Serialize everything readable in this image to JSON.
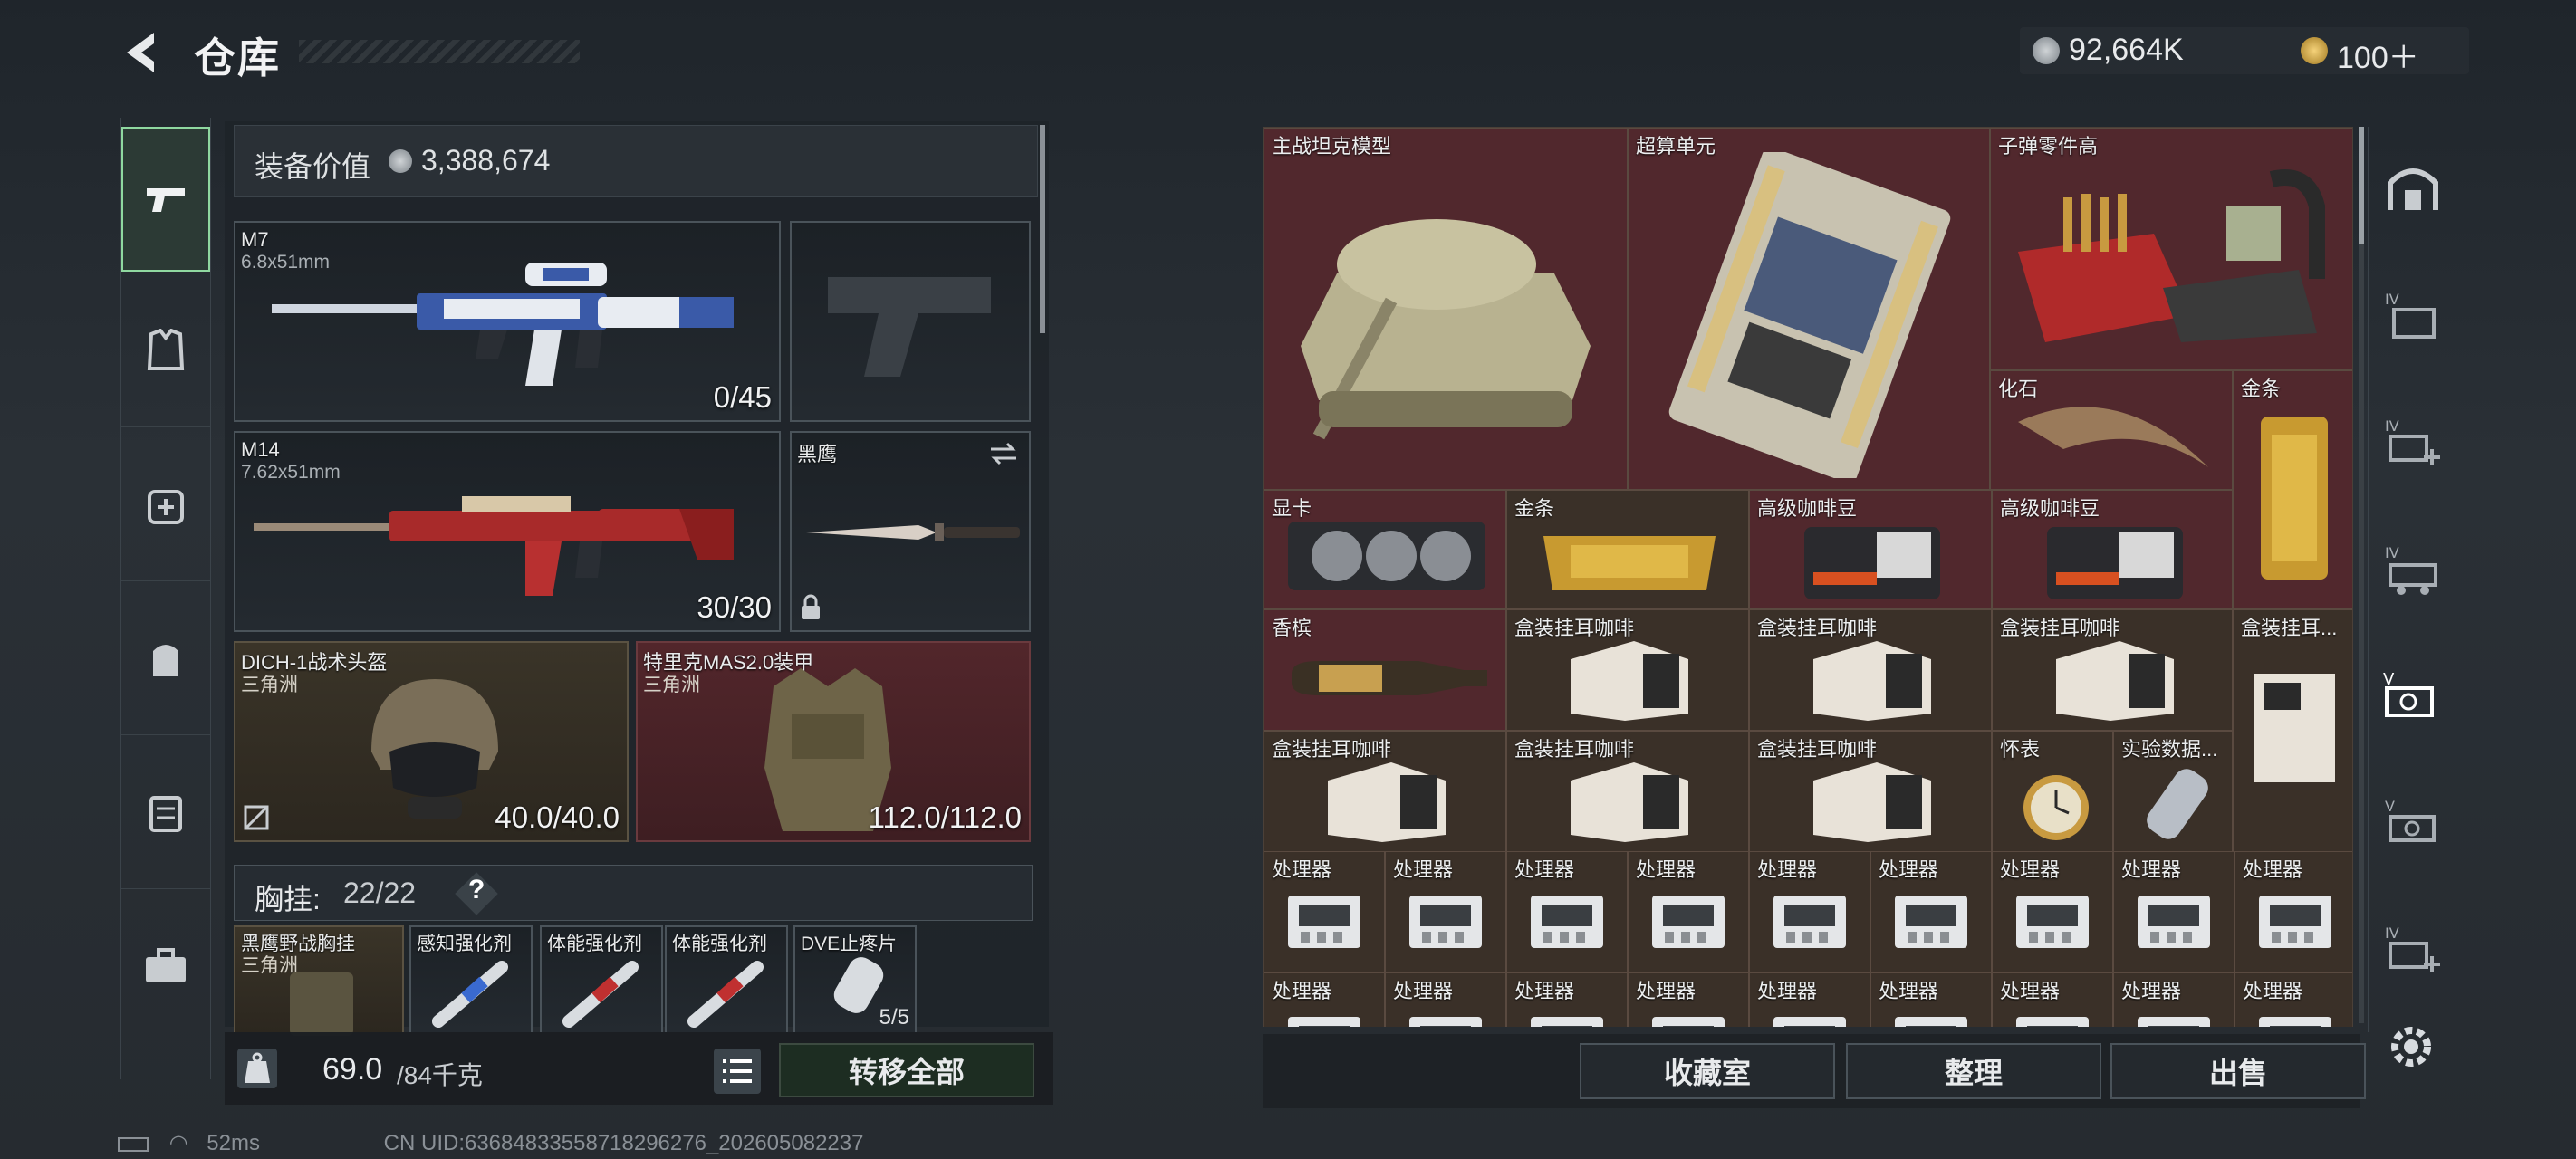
{
  "header": {
    "title": "仓库",
    "currency": [
      {
        "icon": "silver-coin-icon",
        "value": "92,664K"
      },
      {
        "icon": "gold-coin-icon",
        "value": "100＋"
      }
    ]
  },
  "equipment": {
    "value_label": "装备价值",
    "value": "3,388,674",
    "primary": {
      "name": "M7",
      "caliber": "6.8x51mm",
      "ammo": "0/45"
    },
    "secondary": {
      "name": "M14",
      "caliber": "7.62x51mm",
      "ammo": "30/30"
    },
    "melee": {
      "name": "黑鹰"
    },
    "helmet": {
      "name": "DICH-1战术头盔",
      "origin": "三角洲",
      "durability": "40.0/40.0"
    },
    "armor": {
      "name": "特里克MAS2.0装甲",
      "origin": "三角洲",
      "durability": "112.0/112.0"
    },
    "chest_rig": {
      "label": "胸挂:",
      "count": "22/22",
      "help": "?"
    },
    "items": [
      {
        "name": "黑鹰野战胸挂",
        "origin": "三角洲"
      },
      {
        "name": "感知强化剂"
      },
      {
        "name": "体能强化剂"
      },
      {
        "name": "体能强化剂"
      },
      {
        "name": "DVE止疼片",
        "count": "5/5"
      }
    ],
    "weight": "69.0",
    "weight_max": "/84千克",
    "transfer_all": "转移全部"
  },
  "warehouse": {
    "items": [
      {
        "name": "主战坦克模型",
        "icon": "tank-model-icon"
      },
      {
        "name": "超算单元",
        "icon": "supercomputer-board-icon"
      },
      {
        "name": "子弹零件高",
        "icon": "ammo-parts-icon"
      },
      {
        "name": "化石",
        "icon": "fossil-claw-icon"
      },
      {
        "name": "金条",
        "icon": "gold-bar-icon"
      },
      {
        "name": "显卡",
        "icon": "graphics-card-icon"
      },
      {
        "name": "金条",
        "icon": "gold-bar-icon"
      },
      {
        "name": "高级咖啡豆",
        "icon": "coffee-bag-icon"
      },
      {
        "name": "高级咖啡豆",
        "icon": "coffee-bag-icon"
      },
      {
        "name": "香槟",
        "icon": "champagne-icon"
      },
      {
        "name": "盒装挂耳咖啡",
        "icon": "coffee-box-icon"
      },
      {
        "name": "盒装挂耳咖啡",
        "icon": "coffee-box-icon"
      },
      {
        "name": "盒装挂耳咖啡",
        "icon": "coffee-box-icon"
      },
      {
        "name": "盒装挂耳...",
        "icon": "coffee-box-icon"
      },
      {
        "name": "盒装挂耳咖啡",
        "icon": "coffee-box-icon"
      },
      {
        "name": "盒装挂耳咖啡",
        "icon": "coffee-box-icon"
      },
      {
        "name": "盒装挂耳咖啡",
        "icon": "coffee-box-icon"
      },
      {
        "name": "怀表",
        "icon": "pocket-watch-icon"
      },
      {
        "name": "实验数据...",
        "icon": "data-capsule-icon"
      },
      {
        "name": "处理器",
        "icon": "processor-icon"
      }
    ],
    "buttons": {
      "collection": "收藏室",
      "organize": "整理",
      "sell": "出售"
    }
  },
  "status": {
    "ping": "52ms",
    "uid": "CN UID:6368483355871829627­6_202605082237"
  },
  "colors": {
    "accent": "#8fd8a0",
    "red_rarity": "#4a2a2c",
    "gold_rarity": "#3a3028"
  }
}
